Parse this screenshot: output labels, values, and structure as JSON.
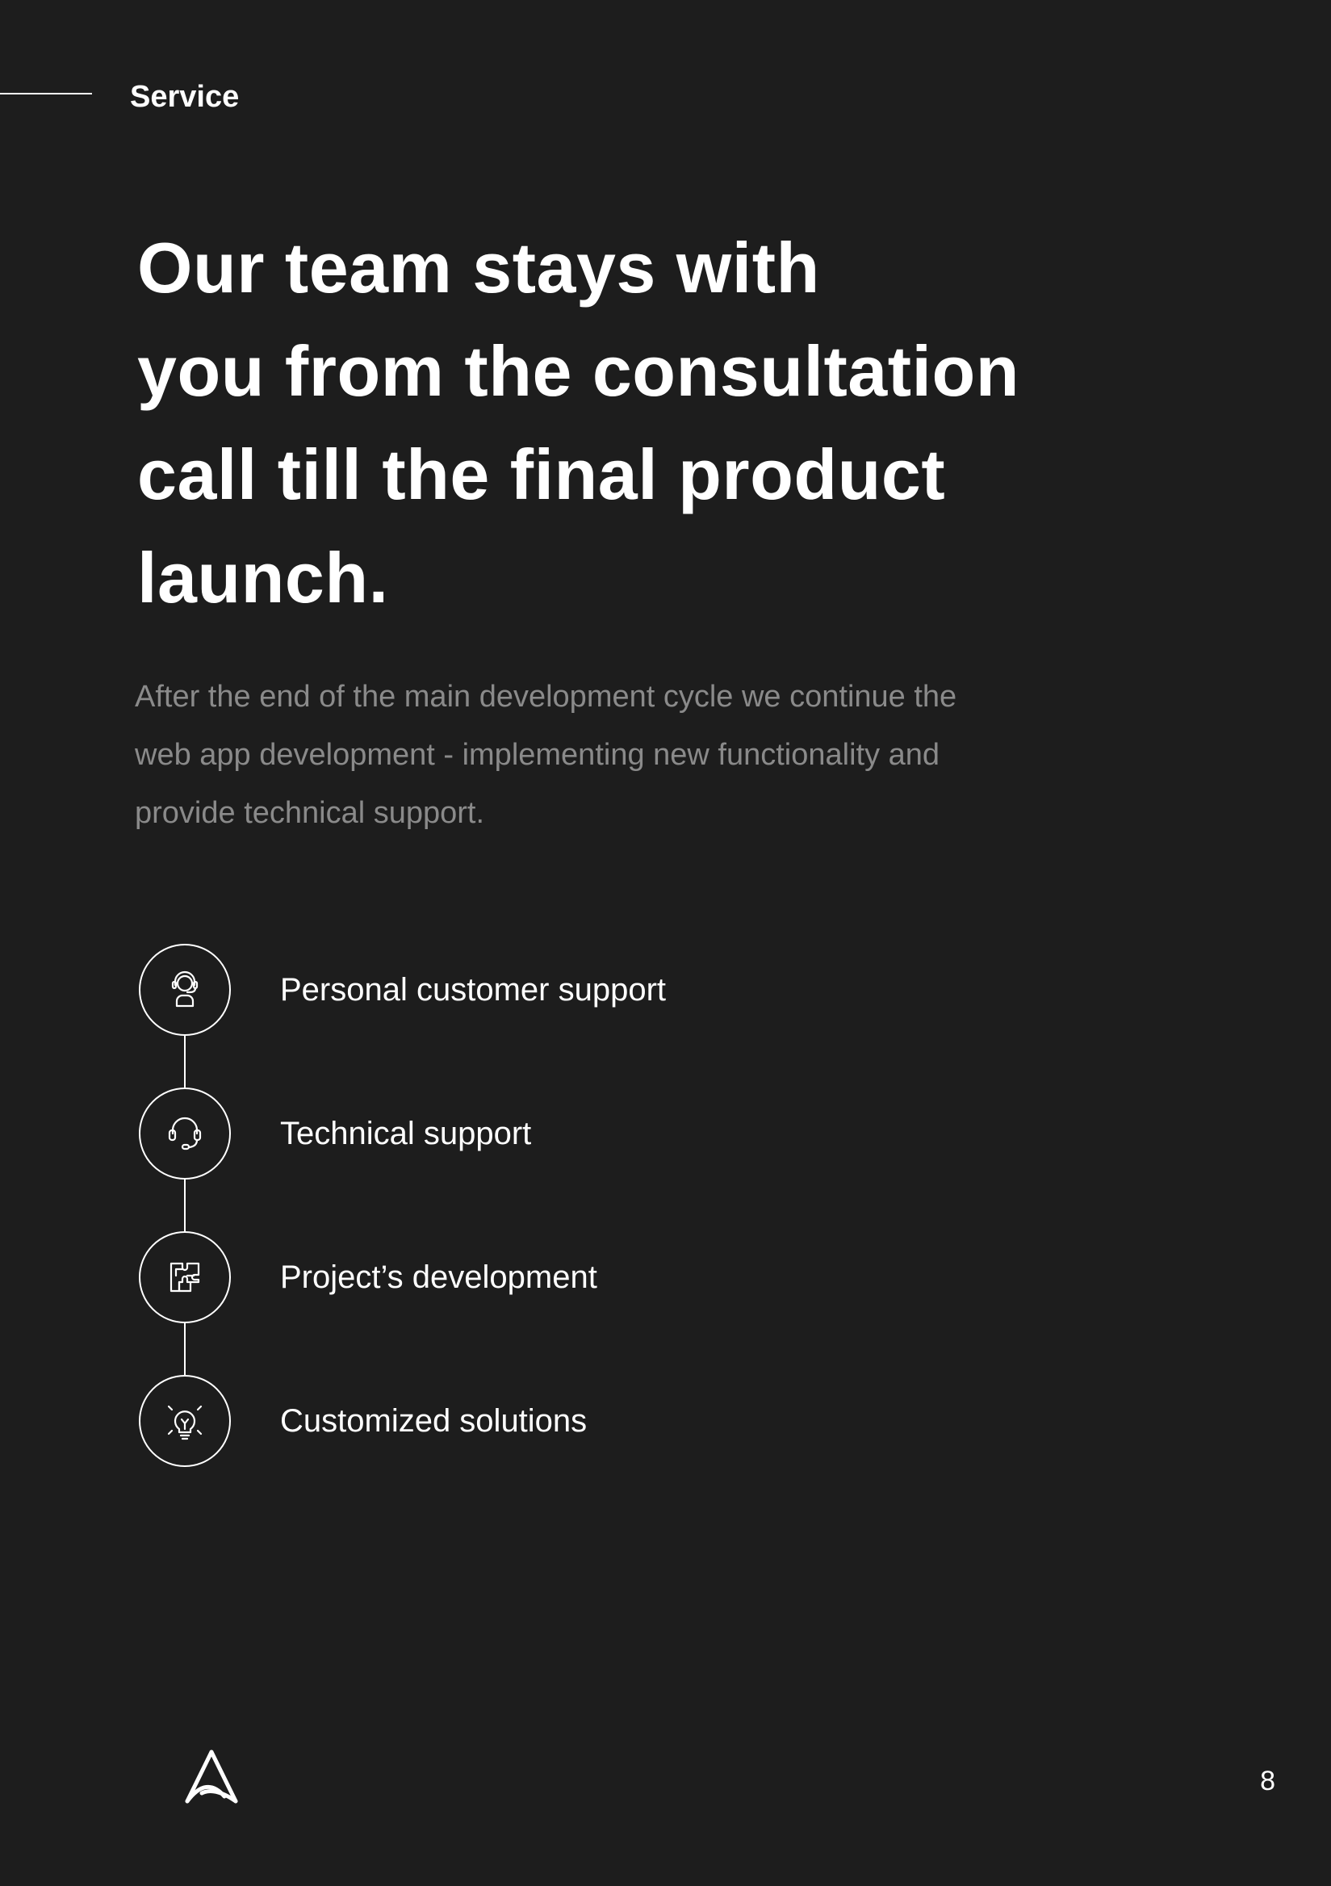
{
  "header": {
    "section_label": "Service"
  },
  "headline": {
    "lines": [
      "Our team stays with",
      "you from the consultation",
      "call till the final product",
      "launch."
    ]
  },
  "description": {
    "lines": [
      "After the end of the main development cycle we continue the",
      "web app development - implementing new functionality and",
      "provide technical support."
    ]
  },
  "features": [
    {
      "label": "Personal customer support",
      "icon": "customer-support-agent-icon"
    },
    {
      "label": "Technical support",
      "icon": "headset-icon"
    },
    {
      "label": "Project’s development",
      "icon": "puzzle-icon"
    },
    {
      "label": "Customized solutions",
      "icon": "lightbulb-icon"
    }
  ],
  "footer": {
    "logo": "company-logo-icon",
    "page_number": "8"
  },
  "colors": {
    "background": "#1d1d1d",
    "text_primary": "#ffffff",
    "text_secondary": "#8a8a8a"
  }
}
